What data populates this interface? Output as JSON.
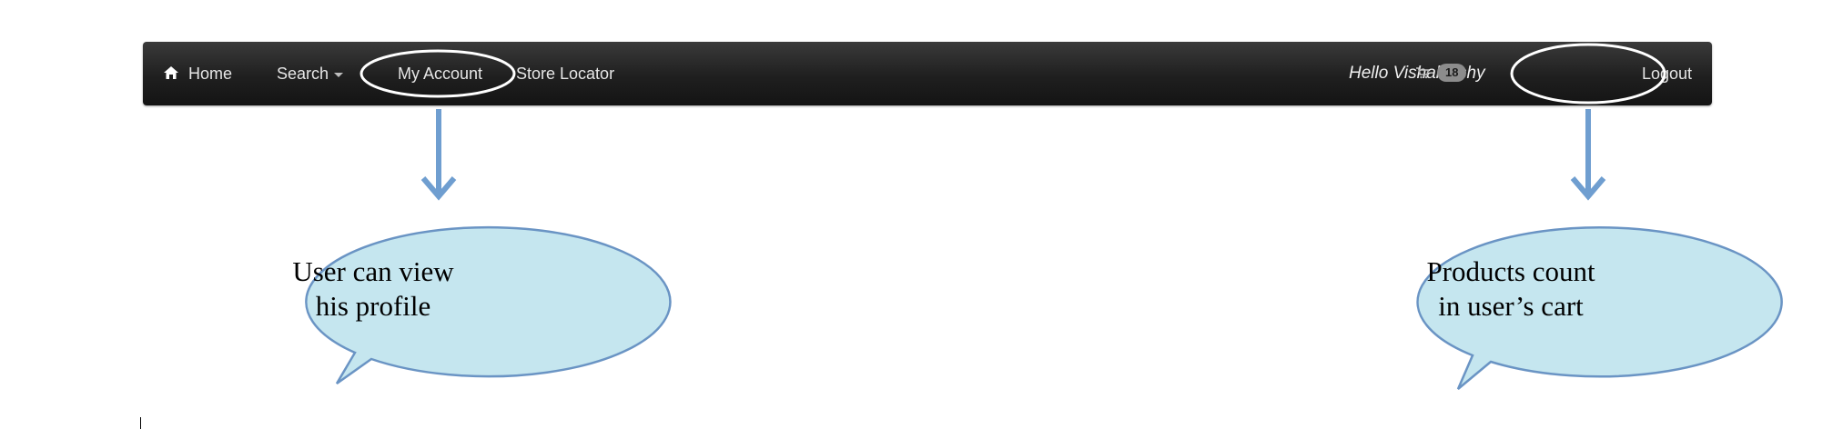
{
  "navbar": {
    "home_label": "Home",
    "search_label": "Search",
    "account_label": "My Account",
    "store_label": "Store Locator",
    "greeting": "Hello Vishalakshy",
    "cart_count": "18",
    "logout_label": "Logout",
    "icons": {
      "home": "home-icon",
      "search_dropdown": "caret-down-icon",
      "cart": "cart-icon"
    }
  },
  "callouts": {
    "account": {
      "line1": "User can view",
      "line2": "his profile"
    },
    "cart": {
      "line1": "Products count",
      "line2": "in user’s cart"
    }
  },
  "colors": {
    "navbar_bg": "#1f1f1f",
    "nav_text": "#e6e6e6",
    "callout_fill": "#c5e6ef",
    "callout_stroke": "#6a94c4",
    "arrow": "#6f9ed0",
    "badge_bg": "#8c8c8c"
  }
}
